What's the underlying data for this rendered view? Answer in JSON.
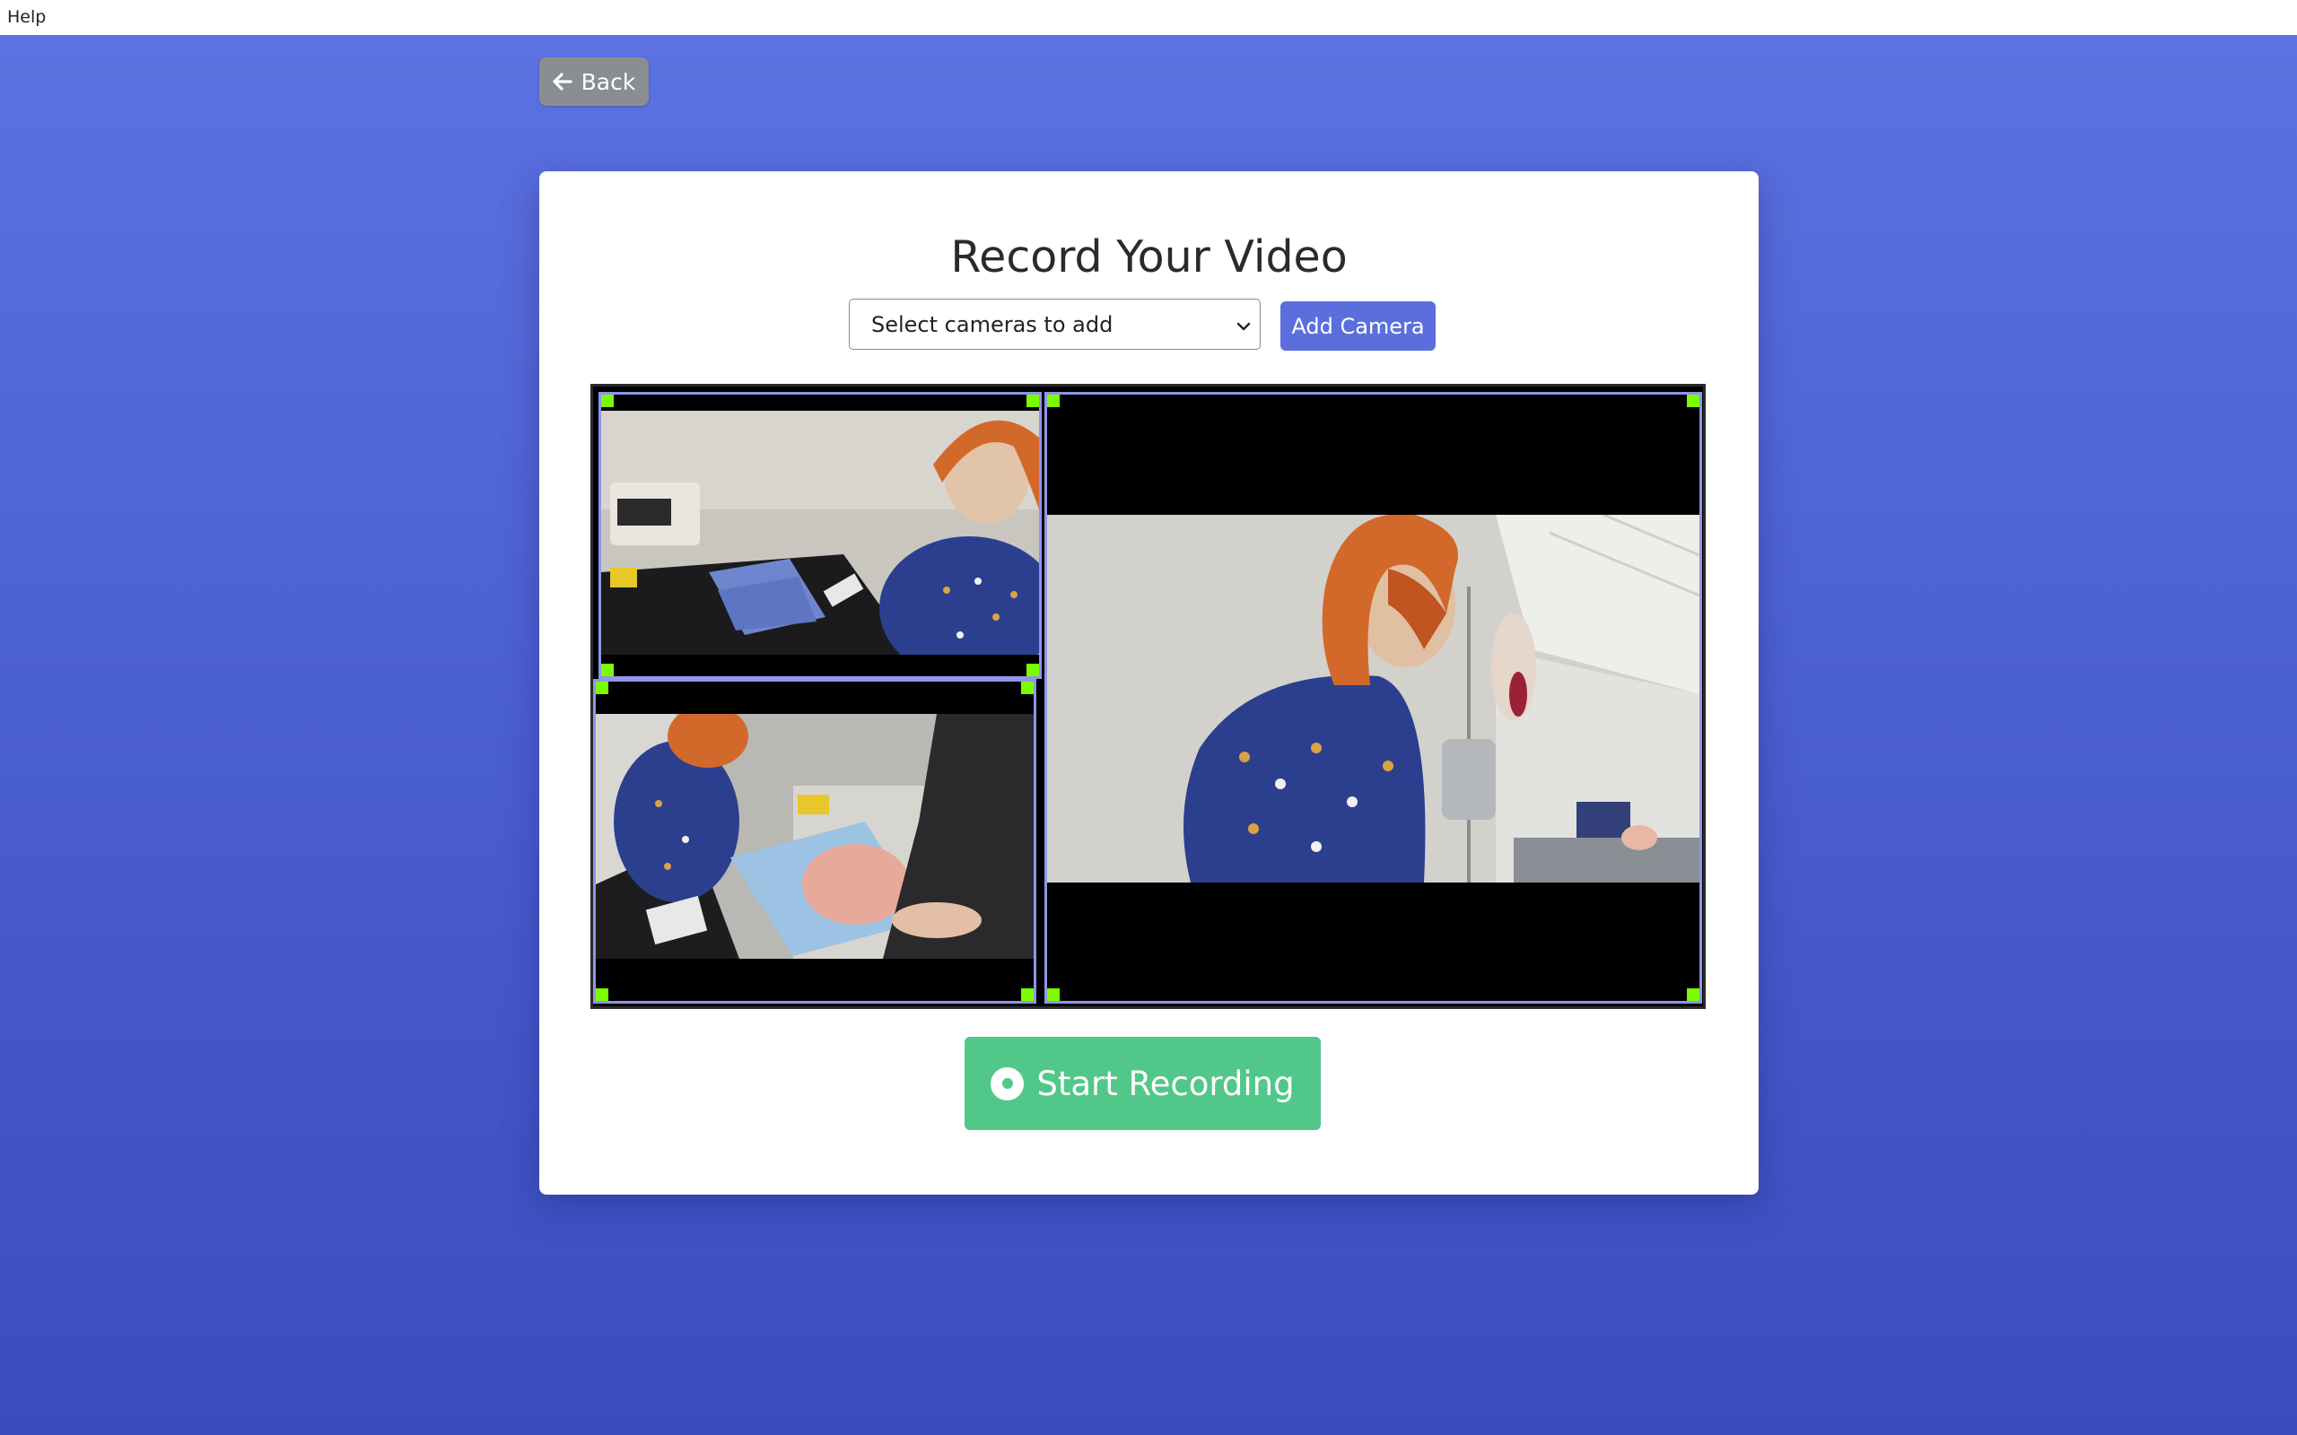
{
  "menubar": {
    "help_label": "Help"
  },
  "nav": {
    "back_label": "Back"
  },
  "recorder": {
    "title": "Record Your Video",
    "camera_select": {
      "value": "Select cameras to add"
    },
    "add_camera_label": "Add Camera",
    "start_recording_label": "Start Recording"
  },
  "cameras": [
    {
      "name": "camera-feed-1",
      "scene": "manikin at counter with supplies"
    },
    {
      "name": "camera-feed-2",
      "scene": "overhead view of hands with equipment"
    },
    {
      "name": "camera-feed-3",
      "scene": "manikin in hospital room"
    }
  ],
  "colors": {
    "background_top": "#5d73e2",
    "background_bottom": "#3b4cbf",
    "back_button": "#8a8d92",
    "add_camera_button": "#5a6fdc",
    "record_button": "#52c78a",
    "tile_border": "#8f95e8",
    "resize_handle": "#7cfc00"
  },
  "icons": {
    "back": "arrow-left-icon",
    "select": "chevron-down-icon",
    "record": "record-circle-icon"
  }
}
